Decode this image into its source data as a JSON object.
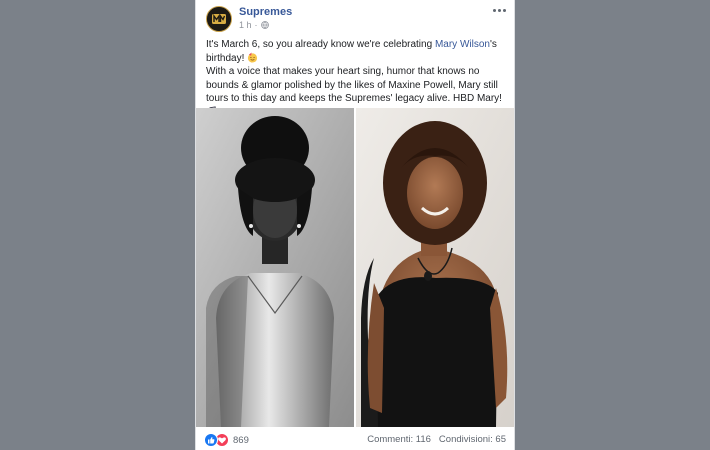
{
  "post": {
    "page_name": "Supremes",
    "time": "1 h",
    "time_separator": "·",
    "privacy_icon": "globe-icon",
    "more_icon": "more-options-icon",
    "text": {
      "line1_before": "It's March 6, so you already know we're celebrating ",
      "mention": "Mary Wilson",
      "line1_after": "'s birthday! ",
      "line1_emoji": "party-face-emoji",
      "paragraph2": "With a voice that makes your heart sing, humor that knows no bounds & glamor polished by the likes of Maxine Powell, Mary still tours to this day and keeps the Supremes' legacy alive. HBD Mary! ",
      "paragraph2_emoji": "musical-notes-emoji"
    },
    "photos": [
      {
        "description_icon": "photo-vintage-portrait"
      },
      {
        "description_icon": "photo-modern-portrait"
      }
    ],
    "footer": {
      "reaction_icons": [
        "like-icon",
        "love-icon"
      ],
      "reaction_count": "869",
      "comments": "Commenti: 116",
      "shares": "Condivisioni: 65"
    }
  },
  "colors": {
    "background": "#7b8189",
    "link": "#385898",
    "like": "#1877f2",
    "love": "#f33e58"
  }
}
